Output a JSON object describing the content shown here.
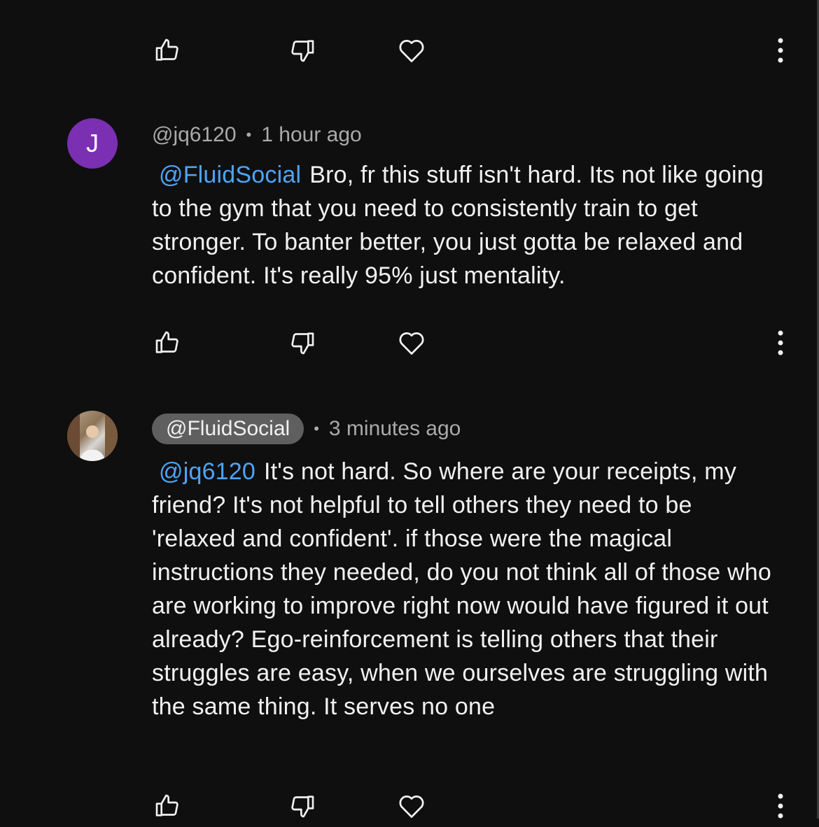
{
  "comments": [
    {
      "avatar_letter": "J",
      "avatar_color": "#7b2fb3",
      "handle": "@jq6120",
      "time": "1 hour ago",
      "mention": "@FluidSocial",
      "text": "Bro, fr this stuff isn't hard. Its not like going to the gym that you need to consistently train to get stronger. To banter better, you just gotta be relaxed and confident. It's really 95% just mentality."
    },
    {
      "avatar_icon": "profile-photo",
      "handle": "@FluidSocial",
      "handle_highlighted": true,
      "time": "3 minutes ago",
      "mention": "@jq6120",
      "text": "It's not hard. So where are your receipts, my friend? It's not helpful to tell others they need to be 'relaxed and confident'. if those were the magical instructions they needed, do you not think all of those who are working to improve right now would have figured it out already? Ego-reinforcement is telling others that their struggles are easy, when we ourselves are struggling with the same thing. It serves no one"
    }
  ],
  "icons": {
    "like": "thumbs-up-icon",
    "dislike": "thumbs-down-icon",
    "heart": "heart-icon",
    "more": "more-vert-icon"
  },
  "colors": {
    "background": "#0f0f0f",
    "mention": "#4ea4f5",
    "meta": "#aaaaaa",
    "handle_pill": "#5f5f5f"
  }
}
